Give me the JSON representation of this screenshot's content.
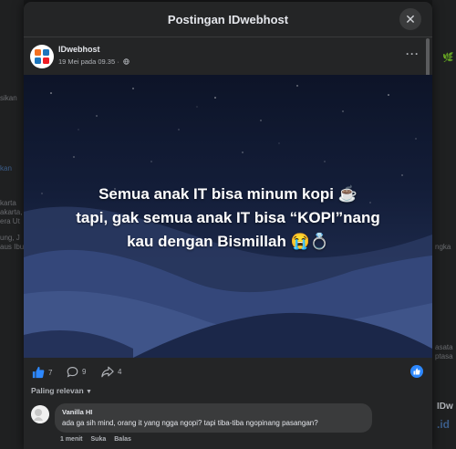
{
  "modal": {
    "title": "Postingan IDwebhost",
    "close_icon": "close-icon"
  },
  "post": {
    "page_name": "IDwebhost",
    "meta": "19 Mei pada 09.35 ·",
    "privacy_icon": "globe-icon",
    "more_label": "···",
    "caption_line1": "Semua anak IT bisa minum kopi ☕",
    "caption_line2": "tapi, gak semua anak IT bisa “KOPI”nang",
    "caption_line3": "kau dengan Bismillah 😭💍"
  },
  "actions": {
    "likes": "7",
    "comments": "9",
    "shares": "4"
  },
  "comments": {
    "sort_label": "Paling relevan",
    "items": [
      {
        "author": "Vanilla HI",
        "text": "ada ga sih mind, orang it yang ngga ngopi? tapi tiba-tiba ngopinang pasangan?",
        "time": "1 menit",
        "like_label": "Suka",
        "reply_label": "Balas"
      }
    ]
  },
  "background": {
    "left_texts": [
      "sikan",
      "kan",
      "karta",
      "akarta,",
      "era Ut",
      "ung, J",
      "aus Ibu"
    ],
    "right_texts": [
      "ngka",
      "asata",
      "ptasa",
      "IDw",
      ".id"
    ]
  },
  "colors": {
    "accent": "#2d88ff",
    "modal_bg": "#242526",
    "page_bg": "#18191a"
  }
}
